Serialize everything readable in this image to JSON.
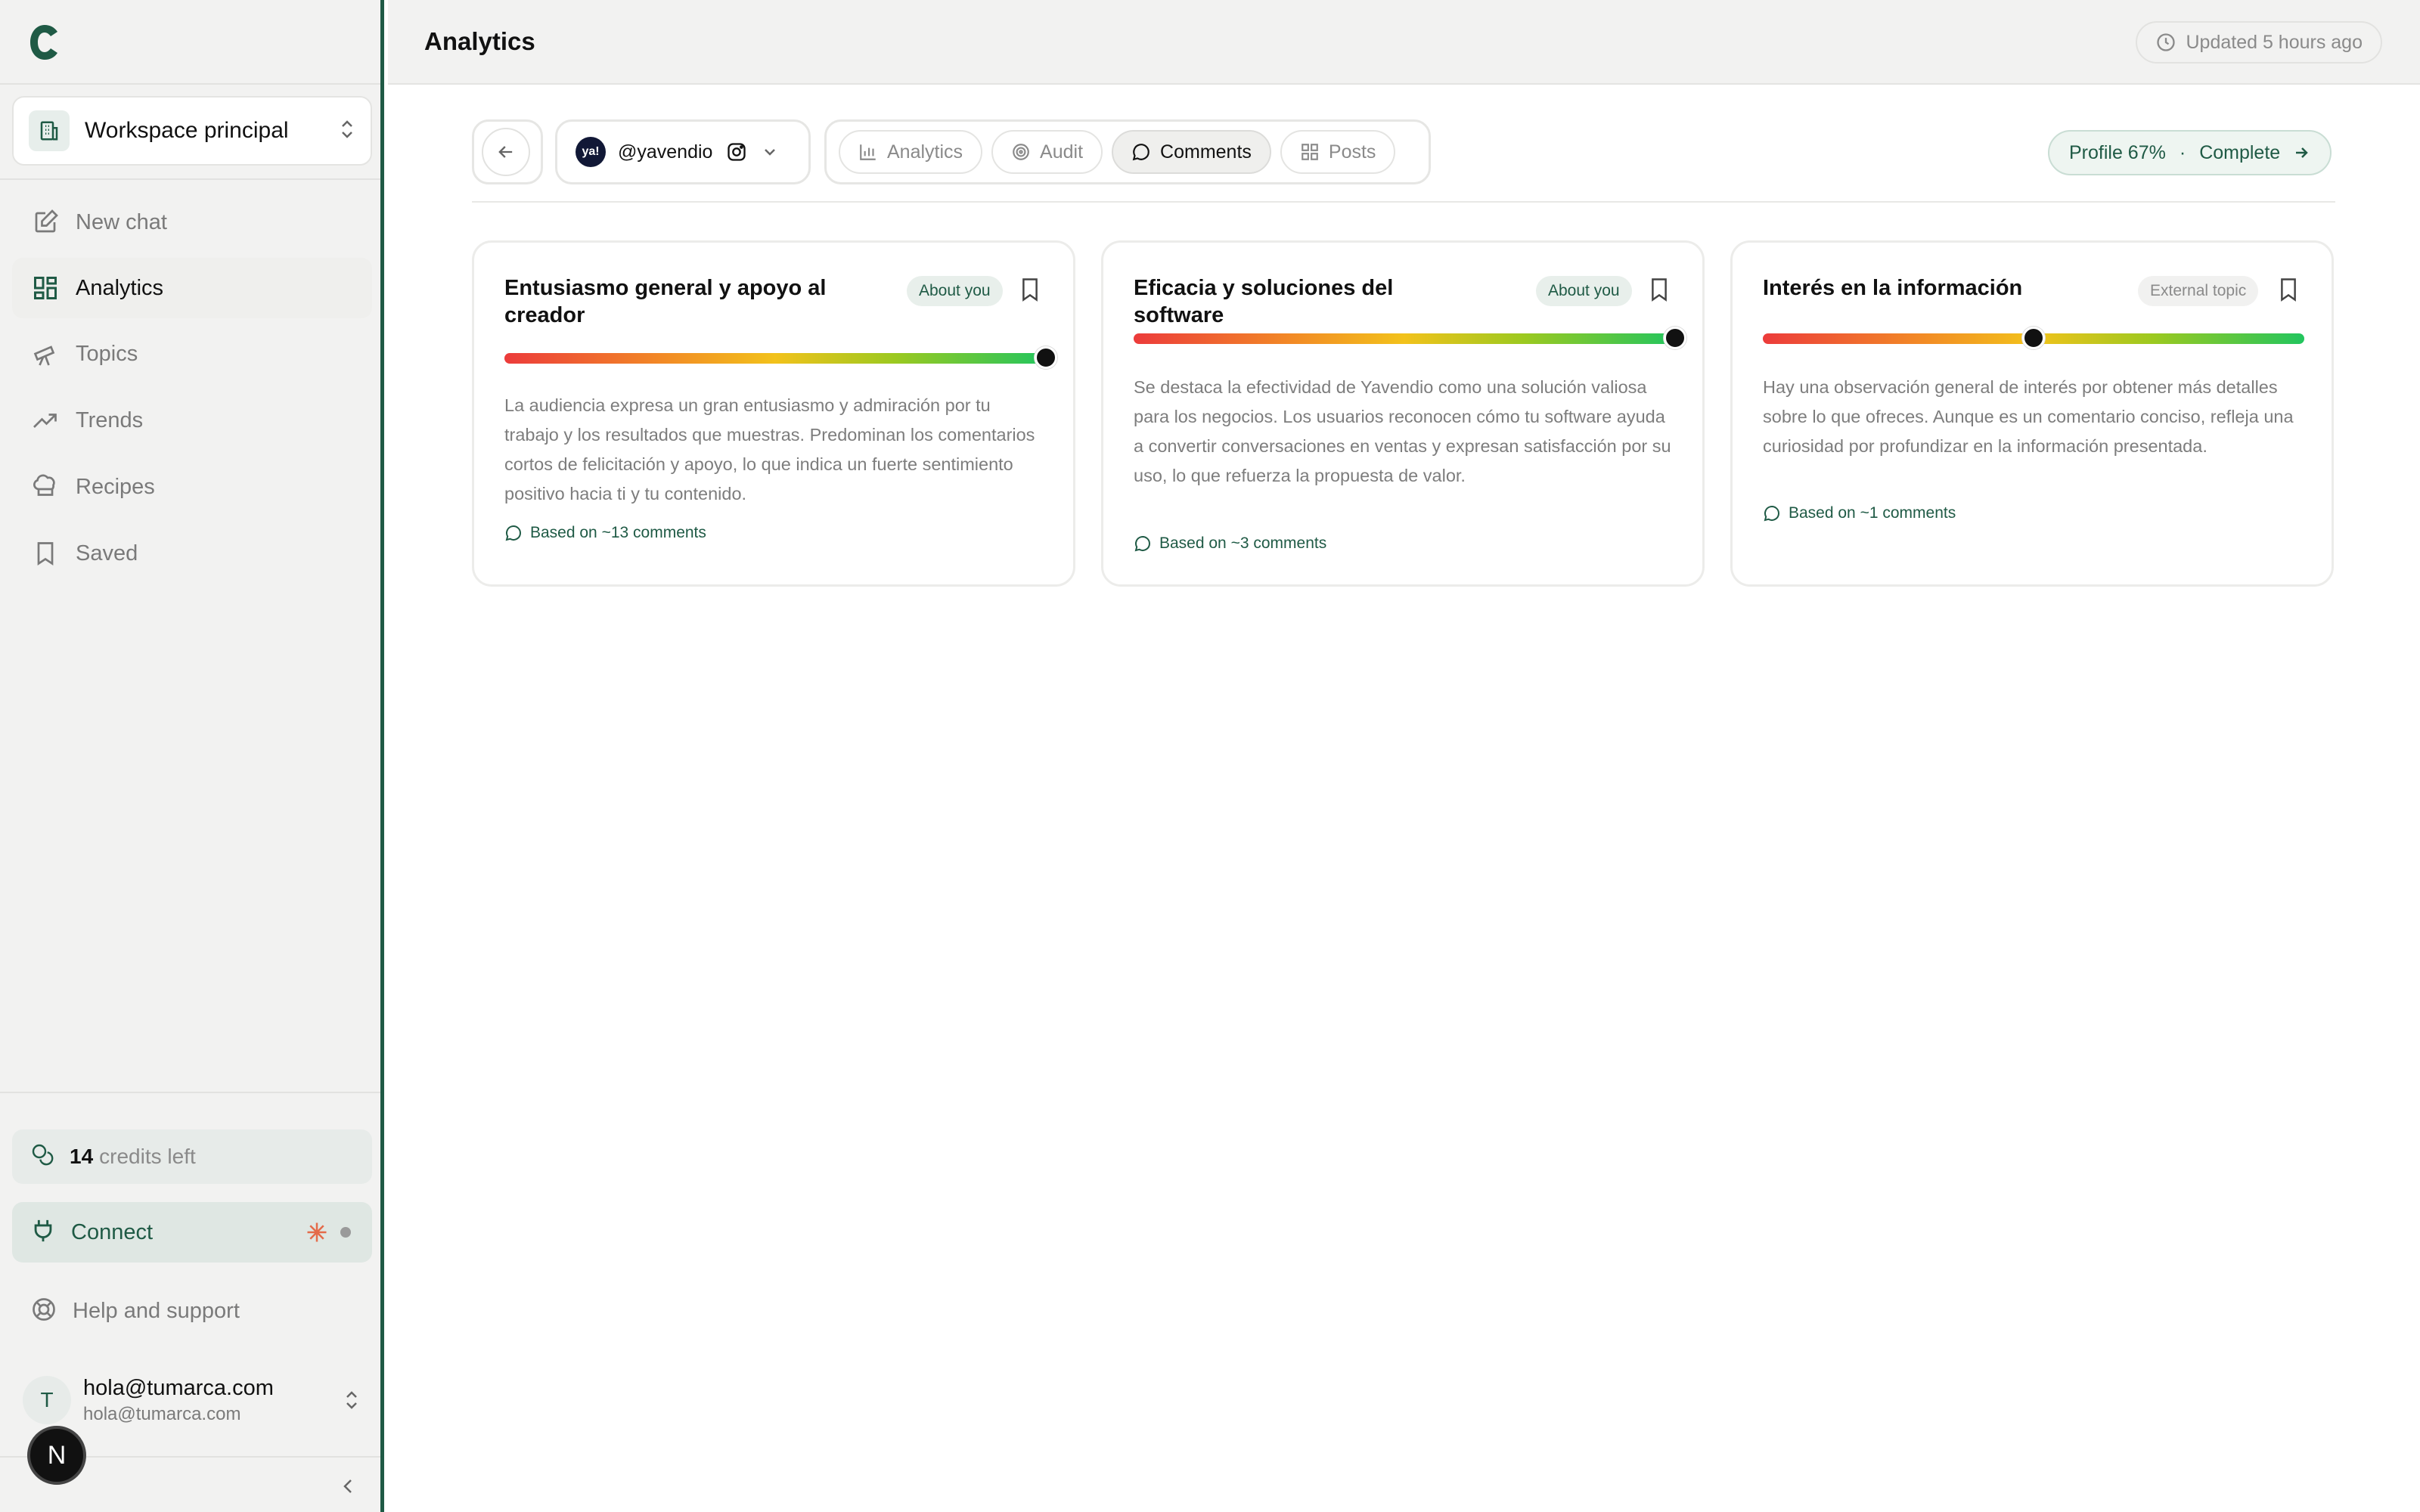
{
  "app": {
    "brand_icon": "brand-logo-c"
  },
  "sidebar": {
    "workspace": {
      "label": "Workspace principal",
      "icon": "building-icon"
    },
    "nav": [
      {
        "label": "New chat",
        "icon": "pencil-square-icon",
        "active": false
      },
      {
        "label": "Analytics",
        "icon": "grid-icon",
        "active": true
      },
      {
        "label": "Topics",
        "icon": "telescope-icon",
        "active": false
      },
      {
        "label": "Trends",
        "icon": "trend-up-icon",
        "active": false
      },
      {
        "label": "Recipes",
        "icon": "chef-hat-icon",
        "active": false
      },
      {
        "label": "Saved",
        "icon": "bookmark-icon",
        "active": false
      }
    ],
    "credits": {
      "count": "14",
      "label": "credits left"
    },
    "connect": {
      "label": "Connect"
    },
    "help": {
      "label": "Help and support"
    },
    "user": {
      "initial": "T",
      "name": "hola@tumarca.com",
      "email": "hola@tumarca.com"
    },
    "badge": "N"
  },
  "header": {
    "title": "Analytics",
    "updated": "Updated 5 hours ago"
  },
  "toolbar": {
    "account": {
      "handle": "@yavendio",
      "avatar_text": "ya!"
    },
    "tabs": [
      {
        "label": "Analytics",
        "icon": "bar-chart-icon",
        "active": false
      },
      {
        "label": "Audit",
        "icon": "target-icon",
        "active": false
      },
      {
        "label": "Comments",
        "icon": "comment-icon",
        "active": true
      },
      {
        "label": "Posts",
        "icon": "grid-icon",
        "active": false
      }
    ],
    "profile": {
      "label": "Profile 67%",
      "sep": "·",
      "action": "Complete"
    }
  },
  "cards": [
    {
      "title": "Entusiasmo general y apoyo al creador",
      "tag": "About you",
      "sentiment": 1.0,
      "body": "La audiencia expresa un gran entusiasmo y admiración por tu trabajo y los resultados que muestras. Predominan los comentarios cortos de felicitación y apoyo, lo que indica un fuerte sentimiento positivo hacia ti y tu contenido.",
      "based_on": "Based on ~13 comments"
    },
    {
      "title": "Eficacia y soluciones del software",
      "tag": "About you",
      "sentiment": 1.0,
      "body": "Se destaca la efectividad de Yavendio como una solución valiosa para los negocios. Los usuarios reconocen cómo tu software ayuda a convertir conversaciones en ventas y expresan satisfacción por su uso, lo que refuerza la propuesta de valor.",
      "based_on": "Based on ~3 comments"
    },
    {
      "title": "Interés en la información",
      "tag": "External topic",
      "sentiment": 0.5,
      "body": "Hay una observación general de interés por obtener más detalles sobre lo que ofreces. Aunque es un comentario conciso, refleja una curiosidad por profundizar en la información presentada.",
      "based_on": "Based on ~1 comments"
    }
  ],
  "colors": {
    "accent": "#1f5a45",
    "sidebar_bg": "#f2f2f1",
    "gauge_low": "#ec3b3b",
    "gauge_mid": "#f2c21b",
    "gauge_high": "#22c55e"
  }
}
